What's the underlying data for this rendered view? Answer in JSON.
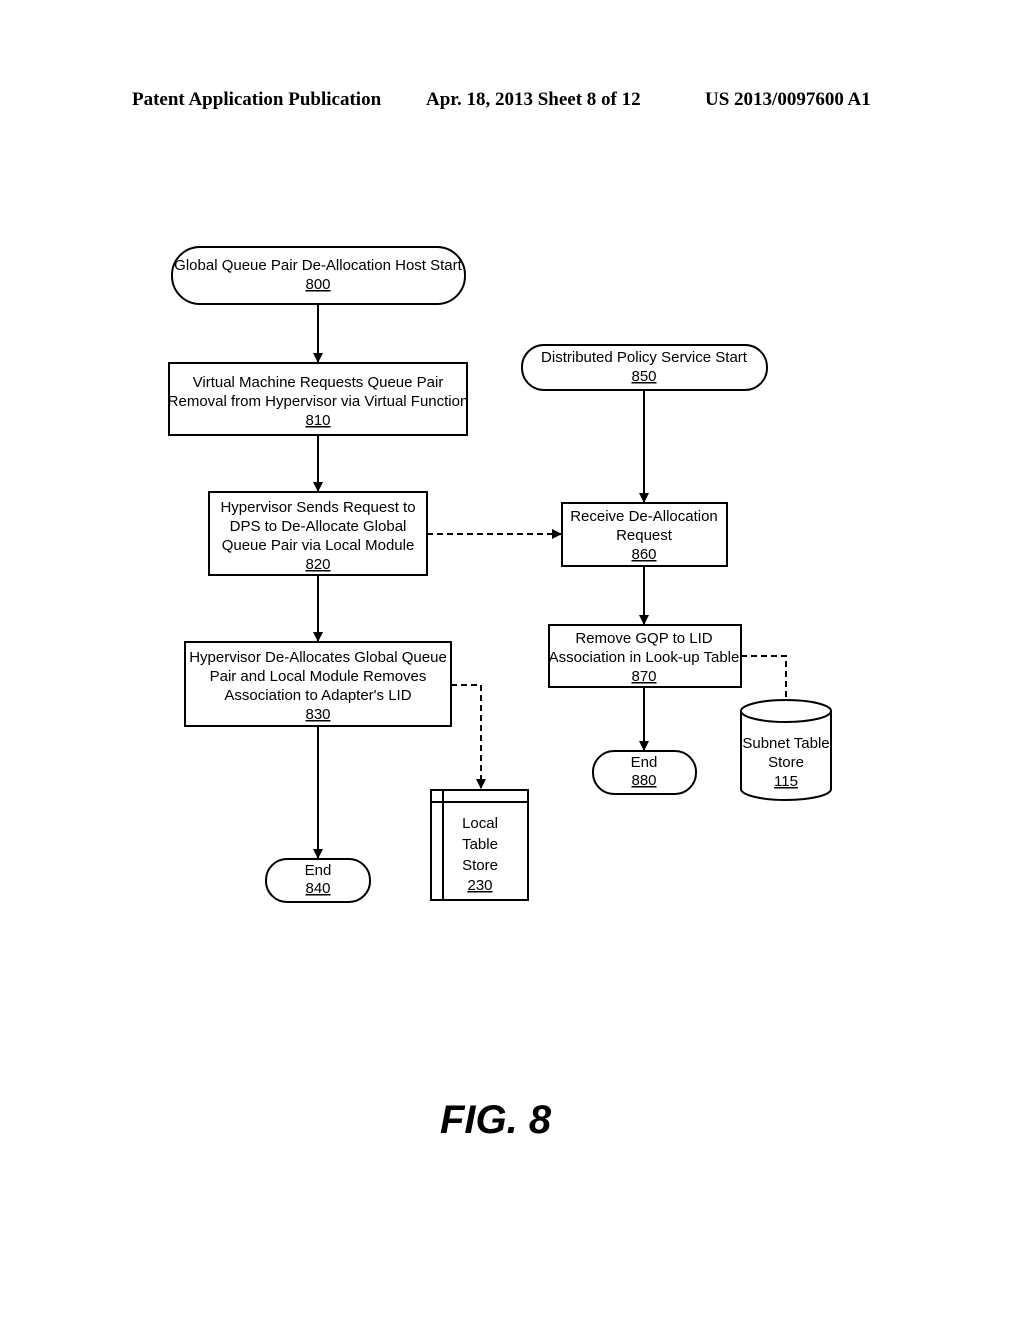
{
  "header": {
    "left": "Patent Application Publication",
    "center": "Apr. 18, 2013  Sheet 8 of 12",
    "right": "US 2013/0097600 A1"
  },
  "figure_label": "FIG. 8",
  "nodes": {
    "n800": {
      "lines": [
        "Global Queue Pair De-Allocation Host Start"
      ],
      "ref": "800",
      "shape": "terminal"
    },
    "n810": {
      "lines": [
        "Virtual Machine Requests Queue Pair",
        "Removal from Hypervisor via Virtual Function"
      ],
      "ref": "810",
      "shape": "process"
    },
    "n820": {
      "lines": [
        "Hypervisor Sends Request to",
        "DPS to De-Allocate Global",
        "Queue Pair via Local Module"
      ],
      "ref": "820",
      "shape": "process"
    },
    "n830": {
      "lines": [
        "Hypervisor De-Allocates Global Queue",
        "Pair and Local Module Removes",
        "Association to Adapter's LID"
      ],
      "ref": "830",
      "shape": "process"
    },
    "n840": {
      "lines": [
        "End"
      ],
      "ref": "840",
      "shape": "terminal"
    },
    "n230": {
      "lines": [
        "Local",
        "Table",
        "Store"
      ],
      "ref": "230",
      "shape": "table-store"
    },
    "n850": {
      "lines": [
        "Distributed Policy Service Start"
      ],
      "ref": "850",
      "shape": "terminal"
    },
    "n860": {
      "lines": [
        "Receive De-Allocation",
        "Request"
      ],
      "ref": "860",
      "shape": "process"
    },
    "n870": {
      "lines": [
        "Remove GQP to LID",
        "Association in Look-up Table"
      ],
      "ref": "870",
      "shape": "process"
    },
    "n880": {
      "lines": [
        "End"
      ],
      "ref": "880",
      "shape": "terminal"
    },
    "n115": {
      "lines": [
        "Subnet Table",
        "Store"
      ],
      "ref": "115",
      "shape": "database"
    }
  },
  "edges": [
    {
      "from": "800",
      "to": "810",
      "style": "solid"
    },
    {
      "from": "810",
      "to": "820",
      "style": "solid"
    },
    {
      "from": "820",
      "to": "830",
      "style": "solid"
    },
    {
      "from": "830",
      "to": "840",
      "style": "solid"
    },
    {
      "from": "830",
      "to": "230",
      "style": "dashed"
    },
    {
      "from": "820",
      "to": "860",
      "style": "dashed"
    },
    {
      "from": "850",
      "to": "860",
      "style": "solid"
    },
    {
      "from": "860",
      "to": "870",
      "style": "solid"
    },
    {
      "from": "870",
      "to": "880",
      "style": "solid"
    },
    {
      "from": "870",
      "to": "115",
      "style": "dashed"
    }
  ]
}
